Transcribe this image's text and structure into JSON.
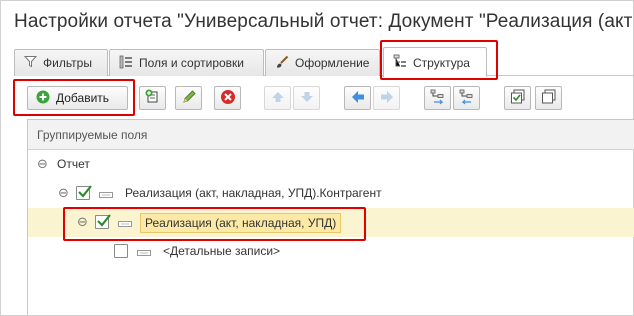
{
  "window": {
    "title": "Настройки отчета \"Универсальный отчет: Документ \"Реализация (акт"
  },
  "tabs": [
    {
      "label": "Фильтры",
      "icon": "funnel-icon",
      "active": false
    },
    {
      "label": "Поля и сортировки",
      "icon": "fields-sort-icon",
      "active": false
    },
    {
      "label": "Оформление",
      "icon": "brush-icon",
      "active": false
    },
    {
      "label": "Структура",
      "icon": "structure-icon",
      "active": true
    }
  ],
  "toolbar": {
    "add_label": "Добавить",
    "buttons": [
      {
        "icon": "add-grouping-icon",
        "enabled": true
      },
      {
        "icon": "edit-pencil-icon",
        "enabled": true
      },
      {
        "icon": "delete-icon",
        "enabled": true
      },
      {
        "icon": "move-up-icon",
        "enabled": false
      },
      {
        "icon": "move-down-icon",
        "enabled": false
      },
      {
        "icon": "level-up-icon",
        "enabled": true
      },
      {
        "icon": "level-down-icon",
        "enabled": false
      },
      {
        "icon": "group-into-icon",
        "enabled": true
      },
      {
        "icon": "ungroup-icon",
        "enabled": true
      },
      {
        "icon": "check-all-icon",
        "enabled": true
      },
      {
        "icon": "uncheck-all-icon",
        "enabled": true
      }
    ]
  },
  "grid": {
    "header": "Группируемые поля",
    "rows": [
      {
        "label": "Отчет",
        "checked": null,
        "expanded": true,
        "level": 0
      },
      {
        "label": "Реализация (акт, накладная, УПД).Контрагент",
        "checked": true,
        "expanded": true,
        "level": 1
      },
      {
        "label": "Реализация (акт, накладная, УПД)",
        "checked": true,
        "expanded": true,
        "level": 2,
        "selected": true
      },
      {
        "label": "<Детальные записи>",
        "checked": false,
        "expanded": null,
        "level": 3
      }
    ]
  },
  "colors": {
    "highlight": "#e00000",
    "selected_row": "#fbf4d0",
    "add_icon": "#3aa33a",
    "delete_icon": "#d42b2b",
    "nav_arrow": "#3f8ee0",
    "check": "#2d8a2d"
  }
}
